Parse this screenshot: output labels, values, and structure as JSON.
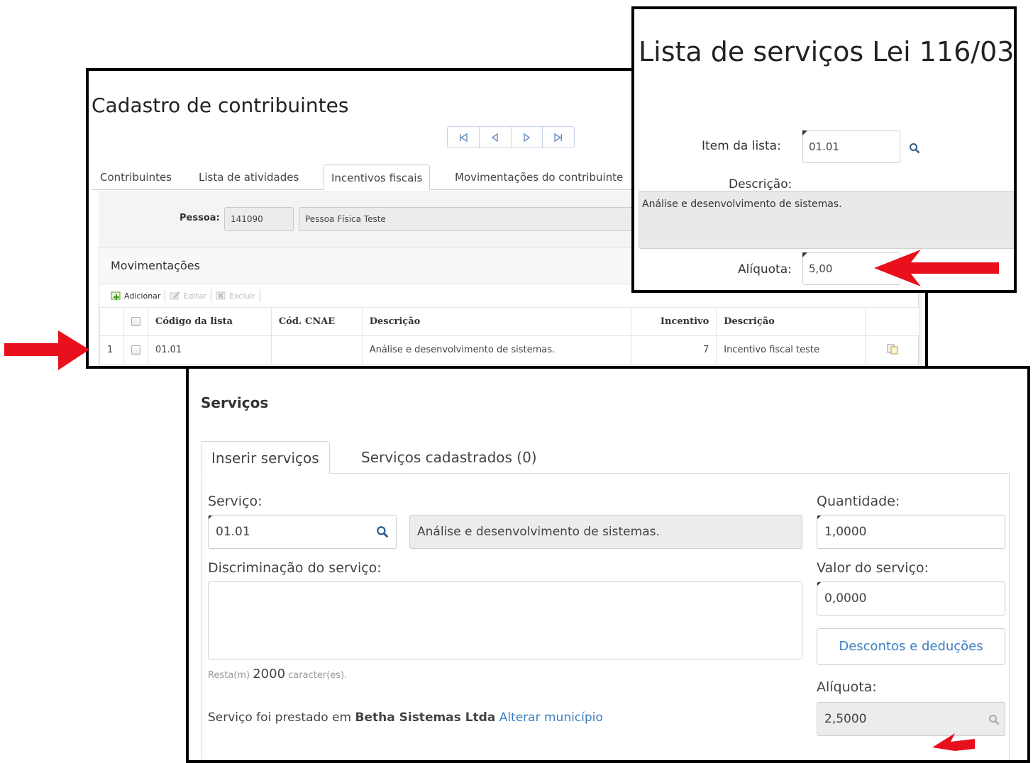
{
  "cadastro": {
    "title": "Cadastro de contribuintes",
    "tabs": [
      "Contribuintes",
      "Lista de atividades",
      "Incentivos fiscais",
      "Movimentações do contribuinte"
    ],
    "pessoa_label": "Pessoa:",
    "pessoa_code": "141090",
    "pessoa_name": "Pessoa Física Teste",
    "movimentacoes_title": "Movimentações",
    "toolbar": {
      "add": "Adicionar",
      "edit": "Editar",
      "delete": "Excluir"
    },
    "table": {
      "headers": [
        "Código da lista",
        "Cód. CNAE",
        "Descrição",
        "Incentivo",
        "Descrição"
      ],
      "rows": [
        {
          "num": "1",
          "codigo": "01.01",
          "cnae": "",
          "descricao": "Análise e desenvolvimento de sistemas.",
          "incentivo": "7",
          "descricao_incentivo": "Incentivo fiscal teste"
        }
      ]
    }
  },
  "lista": {
    "title": "Lista de serviços Lei 116/03",
    "item_label": "Item da lista:",
    "item_value": "01.01",
    "descricao_label": "Descrição:",
    "descricao_value": "Análise e desenvolvimento de sistemas.",
    "aliquota_label": "Alíquota:",
    "aliquota_value": "5,00"
  },
  "servicos": {
    "title": "Serviços",
    "tabs": [
      "Inserir serviços",
      "Serviços cadastrados (0)"
    ],
    "servico_label": "Serviço:",
    "servico_code": "01.01",
    "servico_desc": "Análise e desenvolvimento de sistemas.",
    "quantidade_label": "Quantidade:",
    "quantidade_value": "1,0000",
    "discriminacao_label": "Discriminação do serviço:",
    "discriminacao_value": "",
    "valor_label": "Valor do serviço:",
    "valor_value": "0,0000",
    "descontos_button": "Descontos e deduções",
    "resta_prefix": "Resta(m)",
    "resta_count": "2000",
    "resta_suffix": "caracter(es).",
    "aliquota_label": "Alíquota:",
    "aliquota_value": "2,5000",
    "prestado_prefix": "Serviço foi prestado em",
    "prestado_company": "Betha Sistemas Ltda",
    "alterar_link": "Alterar município"
  },
  "colors": {
    "arrow": "#e8101c",
    "link": "#3b7ec2",
    "border": "#000000"
  }
}
